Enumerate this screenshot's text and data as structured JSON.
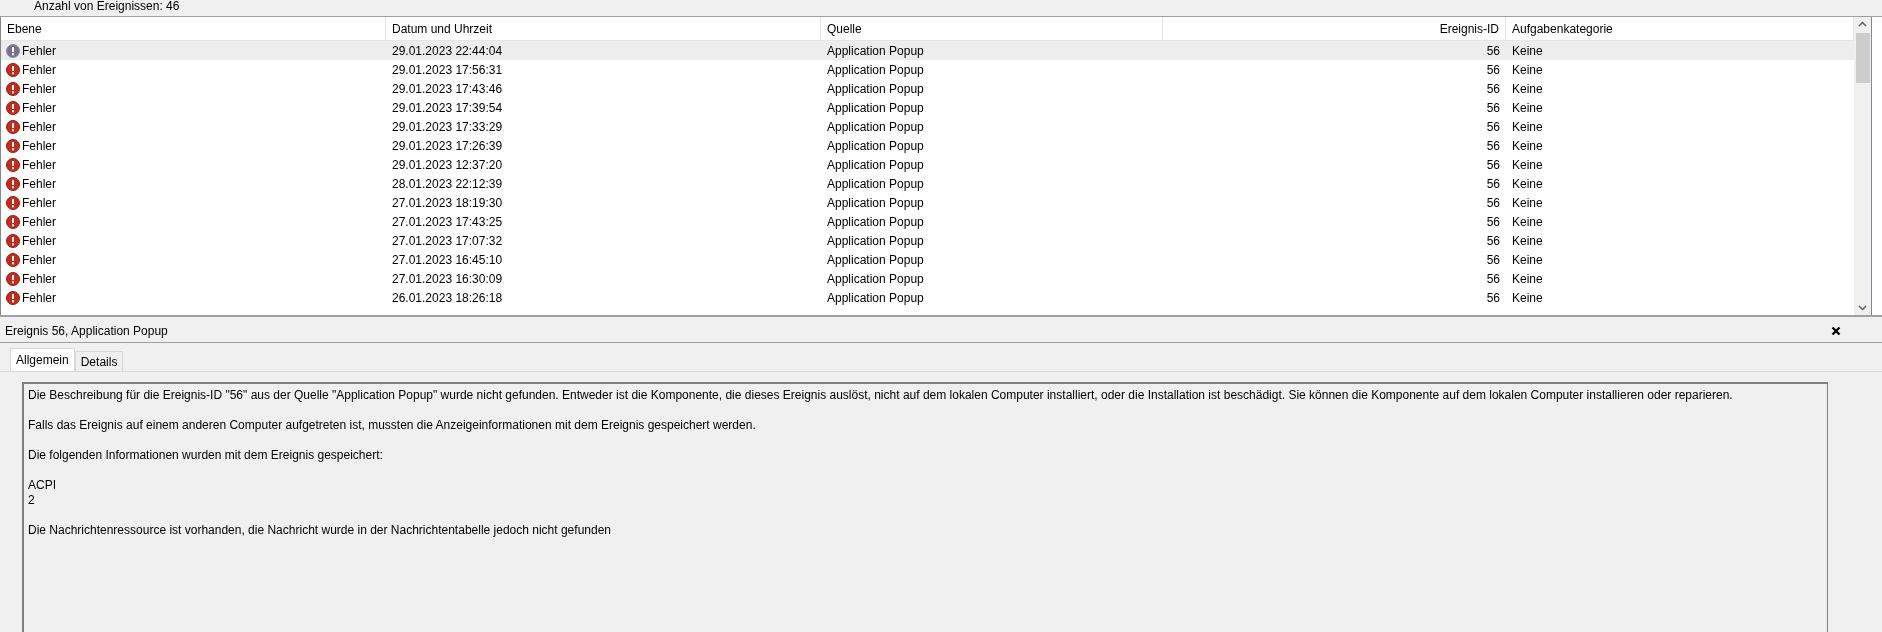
{
  "top_bar": {
    "text": "Anzahl von Ereignissen: 46"
  },
  "table": {
    "columns": [
      "Ebene",
      "Datum und Uhrzeit",
      "Quelle",
      "Ereignis-ID",
      "Aufgabenkategorie"
    ],
    "rows": [
      {
        "level": "Fehler",
        "date": "29.01.2023 22:44:04",
        "source": "Application Popup",
        "id": "56",
        "category": "Keine",
        "selected": true
      },
      {
        "level": "Fehler",
        "date": "29.01.2023 17:56:31",
        "source": "Application Popup",
        "id": "56",
        "category": "Keine",
        "selected": false
      },
      {
        "level": "Fehler",
        "date": "29.01.2023 17:43:46",
        "source": "Application Popup",
        "id": "56",
        "category": "Keine",
        "selected": false
      },
      {
        "level": "Fehler",
        "date": "29.01.2023 17:39:54",
        "source": "Application Popup",
        "id": "56",
        "category": "Keine",
        "selected": false
      },
      {
        "level": "Fehler",
        "date": "29.01.2023 17:33:29",
        "source": "Application Popup",
        "id": "56",
        "category": "Keine",
        "selected": false
      },
      {
        "level": "Fehler",
        "date": "29.01.2023 17:26:39",
        "source": "Application Popup",
        "id": "56",
        "category": "Keine",
        "selected": false
      },
      {
        "level": "Fehler",
        "date": "29.01.2023 12:37:20",
        "source": "Application Popup",
        "id": "56",
        "category": "Keine",
        "selected": false
      },
      {
        "level": "Fehler",
        "date": "28.01.2023 22:12:39",
        "source": "Application Popup",
        "id": "56",
        "category": "Keine",
        "selected": false
      },
      {
        "level": "Fehler",
        "date": "27.01.2023 18:19:30",
        "source": "Application Popup",
        "id": "56",
        "category": "Keine",
        "selected": false
      },
      {
        "level": "Fehler",
        "date": "27.01.2023 17:43:25",
        "source": "Application Popup",
        "id": "56",
        "category": "Keine",
        "selected": false
      },
      {
        "level": "Fehler",
        "date": "27.01.2023 17:07:32",
        "source": "Application Popup",
        "id": "56",
        "category": "Keine",
        "selected": false
      },
      {
        "level": "Fehler",
        "date": "27.01.2023 16:45:10",
        "source": "Application Popup",
        "id": "56",
        "category": "Keine",
        "selected": false
      },
      {
        "level": "Fehler",
        "date": "27.01.2023 16:30:09",
        "source": "Application Popup",
        "id": "56",
        "category": "Keine",
        "selected": false
      },
      {
        "level": "Fehler",
        "date": "26.01.2023 18:26:18",
        "source": "Application Popup",
        "id": "56",
        "category": "Keine",
        "selected": false
      }
    ]
  },
  "detail": {
    "title": "Ereignis 56, Application Popup",
    "tabs": [
      {
        "label": "Allgemein",
        "selected": true
      },
      {
        "label": "Details",
        "selected": false
      }
    ],
    "paragraphs": [
      "Die Beschreibung für die Ereignis-ID \"56\" aus der Quelle \"Application Popup\" wurde nicht gefunden. Entweder ist die Komponente, die dieses Ereignis auslöst, nicht auf dem lokalen Computer installiert, oder die Installation ist beschädigt. Sie können die Komponente auf dem lokalen Computer installieren oder reparieren.",
      "Falls das Ereignis auf einem anderen Computer aufgetreten ist, mussten die Anzeigeinformationen mit dem Ereignis gespeichert werden.",
      "Die folgenden Informationen wurden mit dem Ereignis gespeichert:",
      "ACPI\n2",
      "Die Nachrichtenressource ist vorhanden, die Nachricht wurde in der Nachrichtentabelle jedoch nicht gefunden"
    ]
  }
}
